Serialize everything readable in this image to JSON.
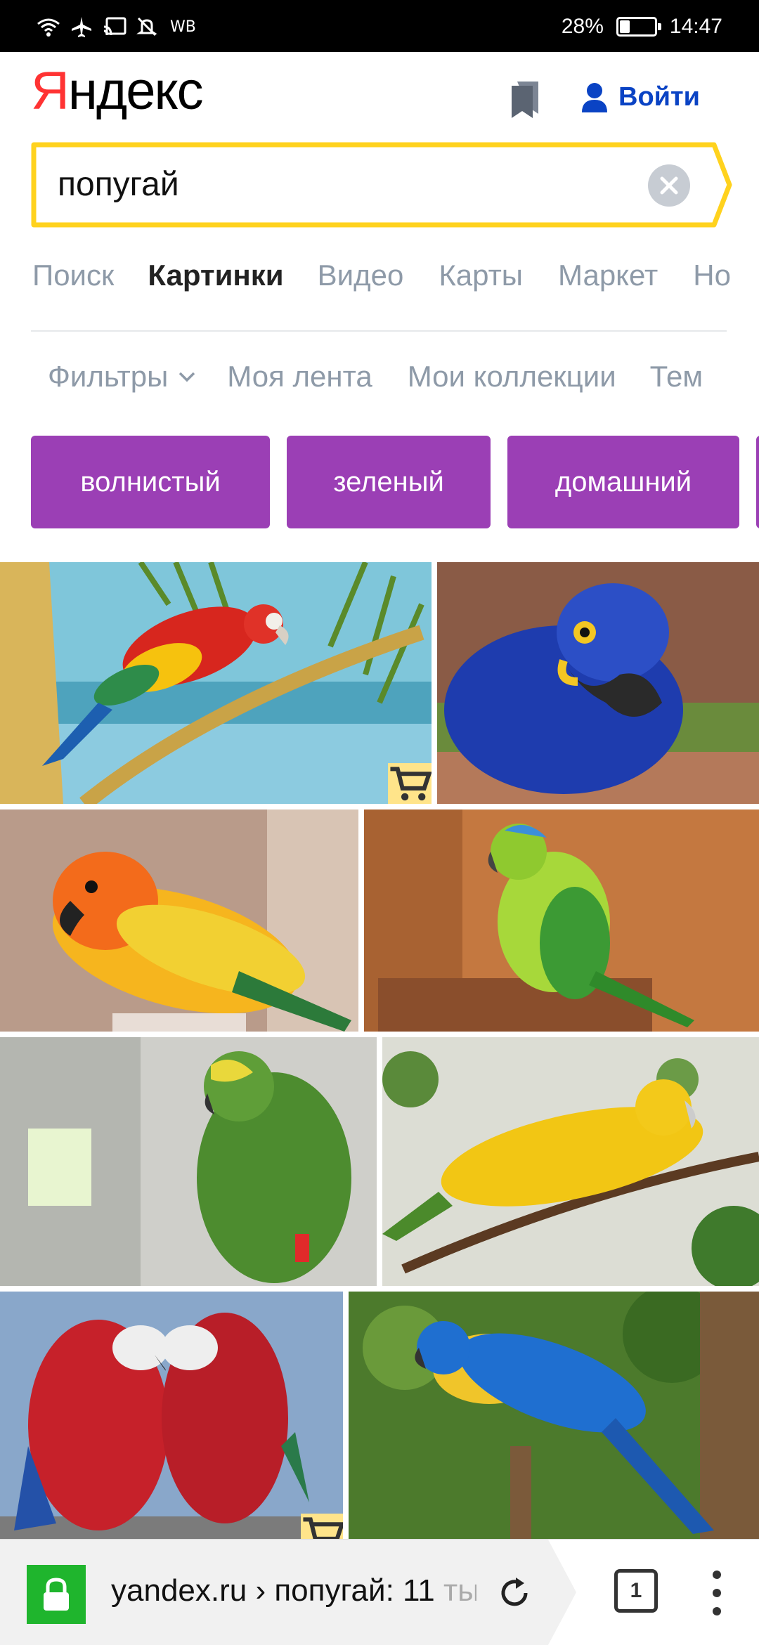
{
  "status_bar": {
    "network": "WB",
    "battery": "28%",
    "time": "14:47"
  },
  "header": {
    "logo_first": "Я",
    "logo_rest": "ндекс",
    "login_label": "Войти"
  },
  "search": {
    "query": "попугай"
  },
  "tabs": [
    {
      "label": "Поиск",
      "active": false
    },
    {
      "label": "Картинки",
      "active": true
    },
    {
      "label": "Видео",
      "active": false
    },
    {
      "label": "Карты",
      "active": false
    },
    {
      "label": "Маркет",
      "active": false
    },
    {
      "label": "Но",
      "active": false
    }
  ],
  "filters": {
    "filters_label": "Фильтры",
    "my_feed": "Моя лента",
    "my_collections": "Мои коллекции",
    "themes": "Тем"
  },
  "chips": [
    "волнистый",
    "зеленый",
    "домашний"
  ],
  "images": [
    {
      "name": "Scarlet macaw on palm",
      "colors": {
        "bg": "#7cc4d8",
        "bird": "#d7261e",
        "accent": "#f6c20e"
      },
      "shop_badge": true
    },
    {
      "name": "Hyacinth macaw",
      "colors": {
        "bg": "#8a5a45",
        "bird": "#1f3fb0",
        "accent": "#f3c623"
      },
      "shop_badge": false
    },
    {
      "name": "Sun conure",
      "colors": {
        "bg": "#b89a88",
        "bird": "#f2891b",
        "accent": "#f7c623"
      },
      "shop_badge": false
    },
    {
      "name": "Green parakeet",
      "colors": {
        "bg": "#c4763f",
        "bird": "#9dd034",
        "accent": "#3b8fd9"
      },
      "shop_badge": false
    },
    {
      "name": "Amazon parrot",
      "colors": {
        "bg": "#c9c9c4",
        "bird": "#4c8b2e",
        "accent": "#e9d83b"
      },
      "shop_badge": false
    },
    {
      "name": "Golden conure",
      "colors": {
        "bg": "#d9dbd2",
        "bird": "#f2c614",
        "accent": "#4b8a2b"
      },
      "shop_badge": false
    },
    {
      "name": "Red macaws pair",
      "colors": {
        "bg": "#88a6c9",
        "bird": "#c6212a",
        "accent": "#2451a8"
      },
      "shop_badge": true
    },
    {
      "name": "Blue-and-yellow macaw",
      "colors": {
        "bg": "#4c7a2c",
        "bird": "#1f6fd0",
        "accent": "#f0c52a"
      },
      "shop_badge": false
    }
  ],
  "browser": {
    "url_host": "yandex.ru › попугай: 11",
    "url_fade": " ты",
    "tab_count": "1"
  }
}
